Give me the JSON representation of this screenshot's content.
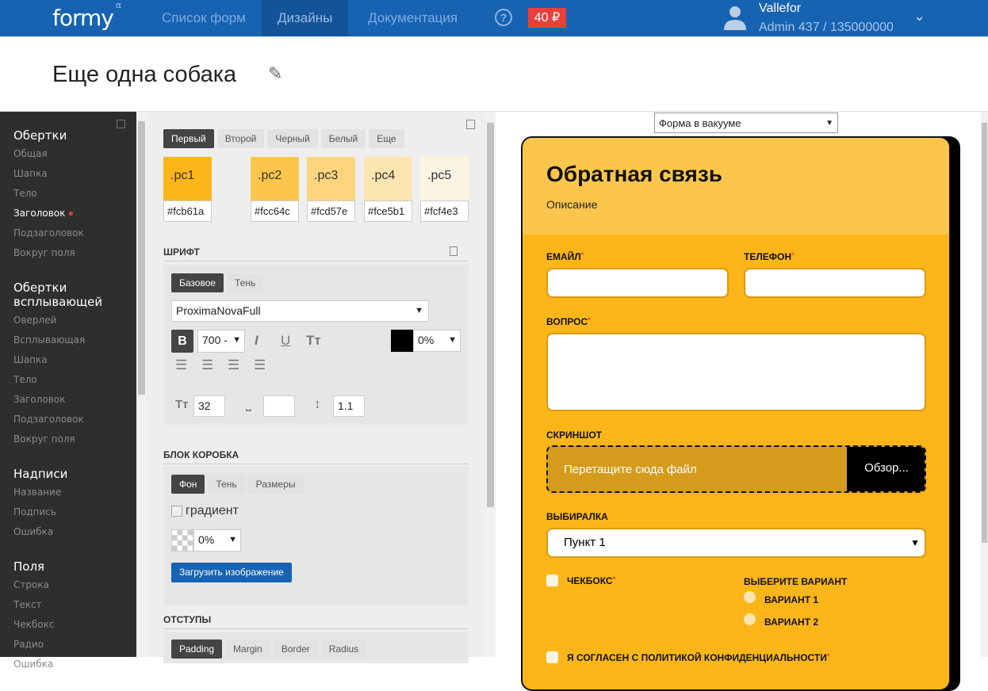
{
  "header": {
    "logo": "formy",
    "logo_sup": "α",
    "nav": [
      "Список форм",
      "Дизайны",
      "Документация"
    ],
    "active_nav": 1,
    "help": "?",
    "balance": "40 ₽",
    "user_name": "Vallefor",
    "user_role": "Admin  437 / 135000000"
  },
  "page_title": "Еще одна собака",
  "sidebar": {
    "groups": [
      {
        "title": "Обертки",
        "items": [
          "Общая",
          "Шапка",
          "Тело",
          "Заголовок",
          "Подзаголовок",
          "Вокруг поля"
        ]
      },
      {
        "title": "Обертки всплывающей",
        "items": [
          "Оверлей",
          "Всплывающая",
          "Шапка",
          "Тело",
          "Заголовок",
          "Подзаголовок",
          "Вокруг поля"
        ]
      },
      {
        "title": "Надписи",
        "items": [
          "Название",
          "Подпись",
          "Ошибка"
        ]
      },
      {
        "title": "Поля",
        "items": [
          "Строка",
          "Текст",
          "Чекбокс",
          "Радио",
          "Ошибка"
        ]
      }
    ],
    "current": "Заголовок"
  },
  "palette": {
    "tabs": [
      "Первый",
      "Второй",
      "Черный",
      "Белый",
      "Еще"
    ],
    "swatches": [
      {
        "name": ".pc1",
        "hex": "#fcb61a"
      },
      {
        "name": ".pc2",
        "hex": "#fcc64c"
      },
      {
        "name": ".pc3",
        "hex": "#fcd57e"
      },
      {
        "name": ".pc4",
        "hex": "#fce5b1"
      },
      {
        "name": ".pc5",
        "hex": "#fcf4e3"
      }
    ]
  },
  "font": {
    "title": "ШРИФТ",
    "tabs": [
      "Базовое",
      "Тень"
    ],
    "family": "ProximaNovaFull",
    "weight": "700 -",
    "bold": "B",
    "color_opacity": "0%",
    "size": "32",
    "spacing": "",
    "line_height": "1.1"
  },
  "box": {
    "title": "БЛОК КОРОБКА",
    "tabs": [
      "Фон",
      "Тень",
      "Размеры"
    ],
    "gradient_label": "градиент",
    "opacity": "0%",
    "upload_label": "Загрузить изображение"
  },
  "spacing": {
    "title": "ОТСТУПЫ",
    "tabs": [
      "Padding",
      "Margin",
      "Border",
      "Radius"
    ]
  },
  "preview": {
    "mode": "Форма в вакууме",
    "form_title": "Обратная связь",
    "form_desc": "Описание",
    "email": "ЕМАЙЛ",
    "phone": "ТЕЛЕФОН",
    "question": "ВОПРОС",
    "screenshot": "СКРИНШОТ",
    "drop": "Перетащите сюда файл",
    "browse": "Обзор...",
    "select_label": "ВЫБИРАЛКА",
    "select_value": "Пункт 1",
    "checkbox": "ЧЕКБОКС",
    "radio_title": "ВЫБЕРИТЕ ВАРИАНТ",
    "radio1": "ВАРИАНТ 1",
    "radio2": "ВАРИАНТ 2",
    "agree": "Я СОГЛАСЕН С ПОЛИТИКОЙ КОНФИДЕНЦИАЛЬНОСТИ"
  }
}
